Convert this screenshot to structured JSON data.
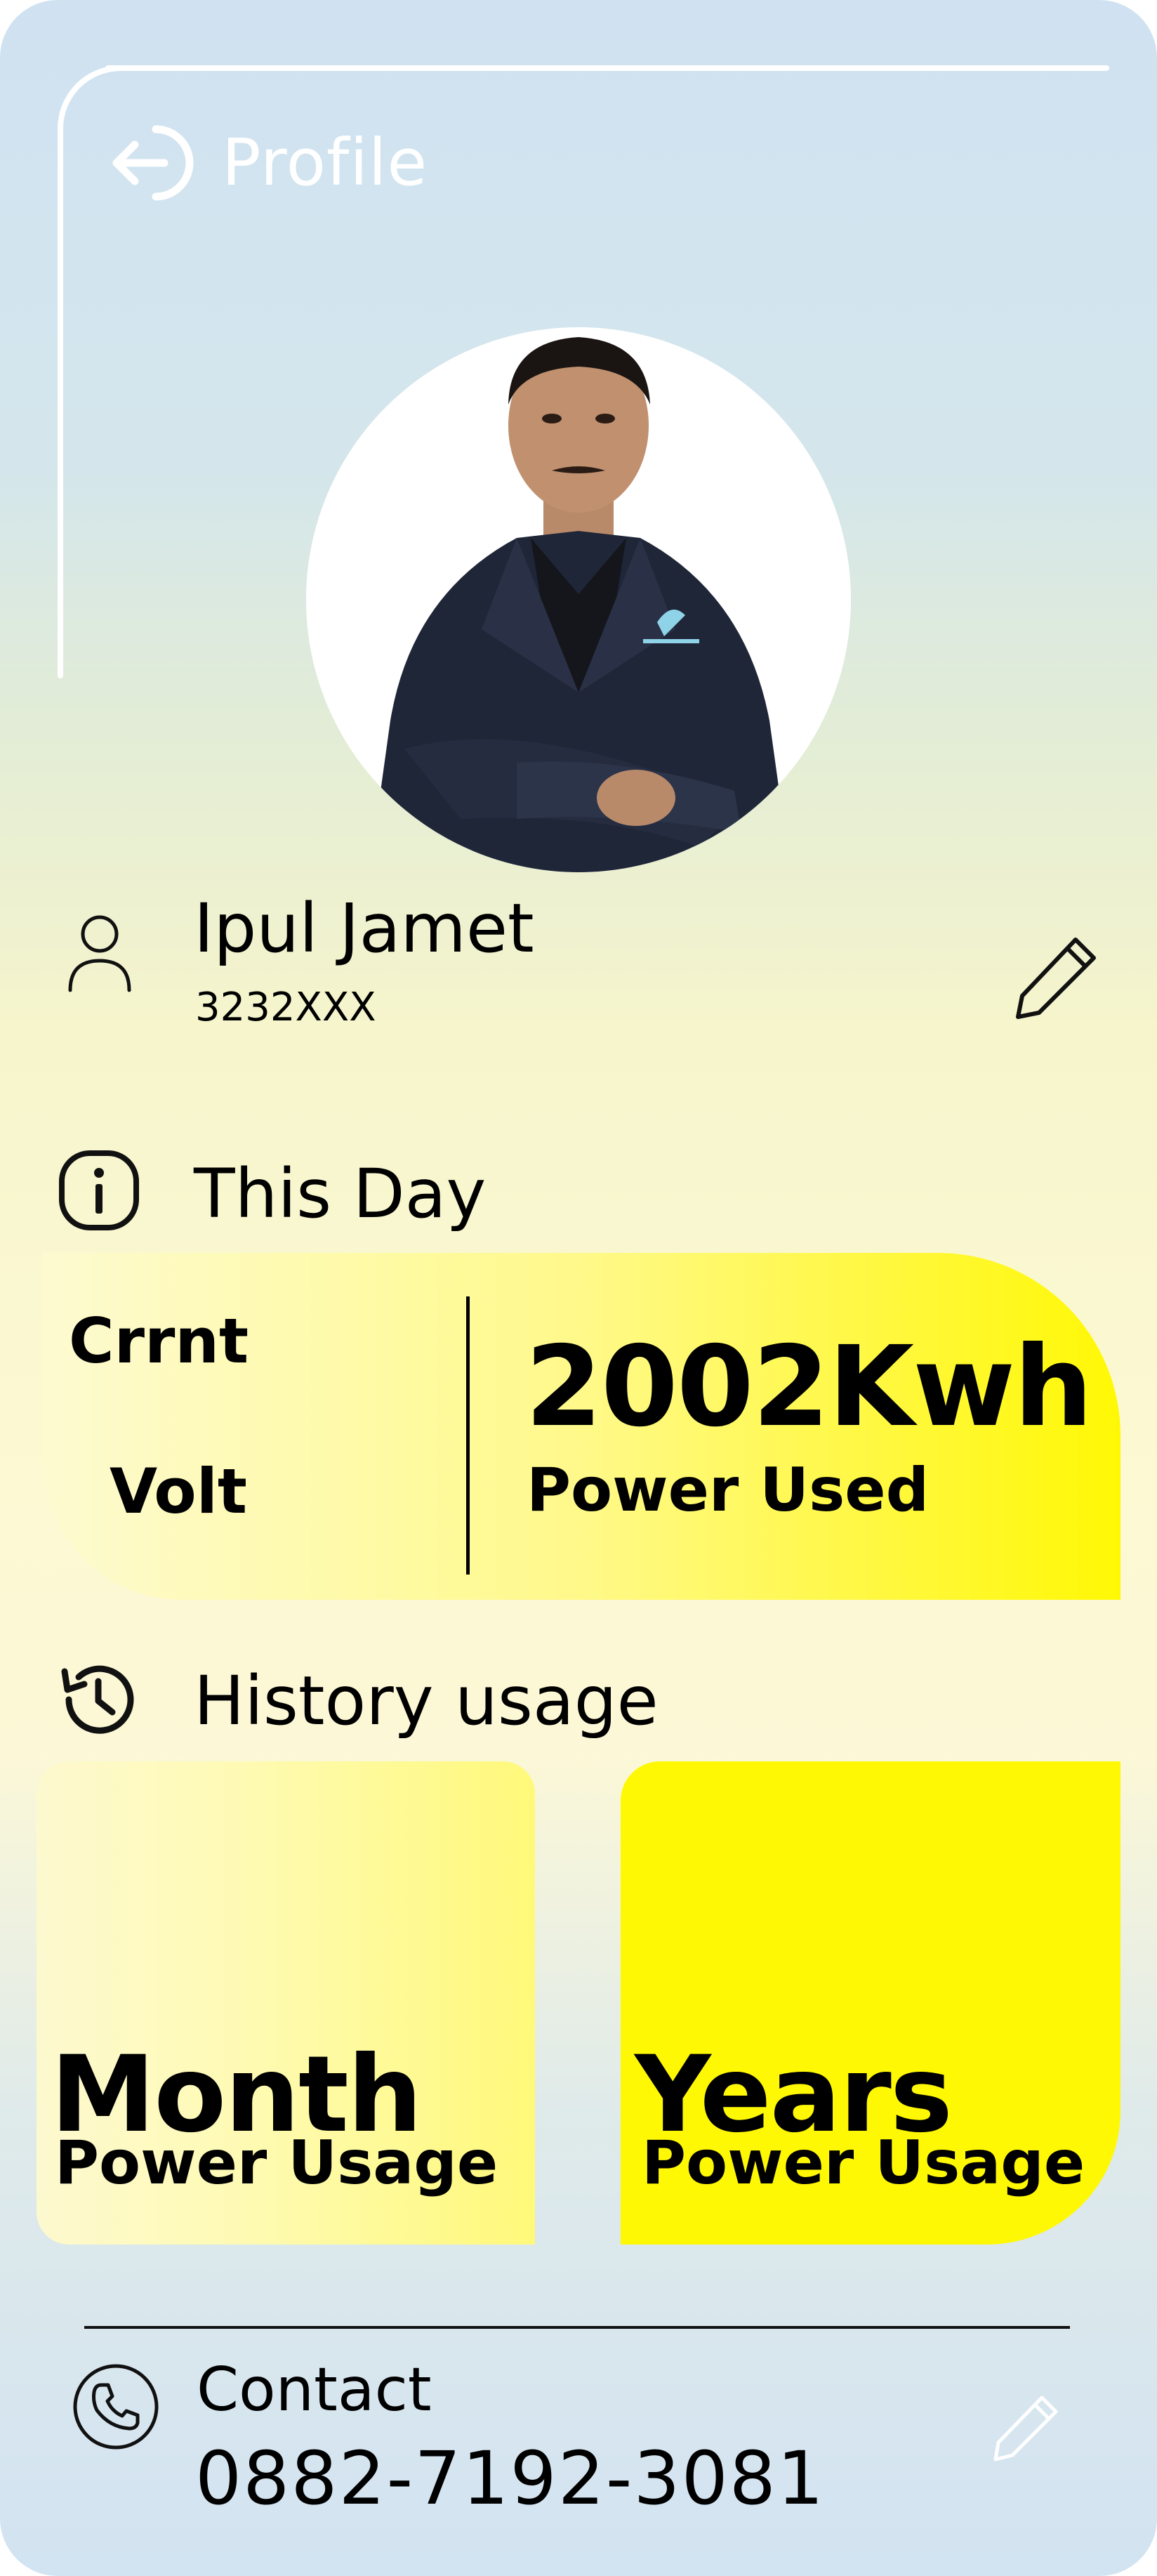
{
  "header": {
    "title": "Profile",
    "back_icon": "back-arrow-icon"
  },
  "profile": {
    "avatar_icon": "avatar-photo",
    "name": "Ipul Jamet",
    "id": "3232XXX",
    "user_icon": "user-icon",
    "edit_icon": "pencil-icon"
  },
  "this_day": {
    "title": "This Day",
    "icon": "info-icon",
    "current_label": "Crrnt",
    "volt_label": "Volt",
    "power_value": "2002Kwh",
    "power_label": "Power Used"
  },
  "history": {
    "title": "History usage",
    "icon": "history-icon",
    "month": {
      "title": "Month",
      "subtitle": "Power Usage"
    },
    "years": {
      "title": "Years",
      "subtitle": "Power Usage"
    }
  },
  "contact": {
    "label": "Contact",
    "number": "0882-7192-3081",
    "icon": "phone-icon",
    "edit_icon": "pencil-icon"
  },
  "colors": {
    "accent_yellow": "#fff804",
    "background_blue": "#d0e2f1",
    "background_cream": "#fcf9d2",
    "header_text": "#ffffff"
  }
}
